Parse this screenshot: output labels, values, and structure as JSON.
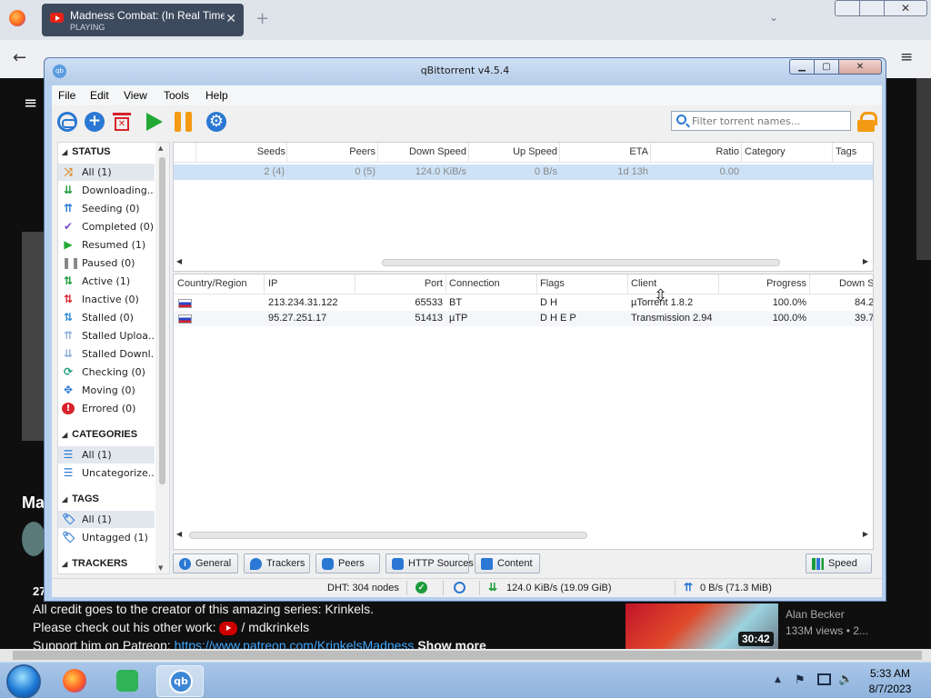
{
  "browser": {
    "tab_title": "Madness Combat: (In Real Time",
    "tab_status": "PLAYING",
    "new_tab": "+",
    "close_tab": "✕"
  },
  "youtube": {
    "title": "Ma",
    "views_fragment": "27",
    "description_line1": "All credit goes to the creator of this amazing series: Krinkels.",
    "description_line2_prefix": "Please check out his other work:",
    "description_line2_channel": "/ mdkrinkels",
    "description_line3_prefix": "Support him on Patreon:",
    "description_line3_link": "https://www.patreon.com/KrinkelsMadness",
    "show_more": "Show more",
    "rec_duration": "30:42",
    "rec_channel": "Alan Becker",
    "rec_views": "133M views • 2..."
  },
  "taskbar": {
    "time": "5:33 AM",
    "date": "8/7/2023",
    "qb_label": "qb"
  },
  "qbittorrent": {
    "window_title": "qBittorrent v4.5.4",
    "menu": [
      "File",
      "Edit",
      "View",
      "Tools",
      "Help"
    ],
    "search_placeholder": "Filter torrent names...",
    "sidebar": {
      "status_header": "STATUS",
      "status_items": [
        {
          "label": "All (1)",
          "icon": "all-icon"
        },
        {
          "label": "Downloading...",
          "icon": "downloading-icon"
        },
        {
          "label": "Seeding (0)",
          "icon": "seeding-icon"
        },
        {
          "label": "Completed (0)",
          "icon": "completed-icon"
        },
        {
          "label": "Resumed (1)",
          "icon": "resumed-icon"
        },
        {
          "label": "Paused (0)",
          "icon": "paused-icon"
        },
        {
          "label": "Active (1)",
          "icon": "active-icon"
        },
        {
          "label": "Inactive (0)",
          "icon": "inactive-icon"
        },
        {
          "label": "Stalled (0)",
          "icon": "stalled-icon"
        },
        {
          "label": "Stalled Uploa...",
          "icon": "stalled-uploading-icon"
        },
        {
          "label": "Stalled Downl...",
          "icon": "stalled-downloading-icon"
        },
        {
          "label": "Checking (0)",
          "icon": "checking-icon"
        },
        {
          "label": "Moving (0)",
          "icon": "moving-icon"
        },
        {
          "label": "Errored (0)",
          "icon": "errored-icon"
        }
      ],
      "categories_header": "CATEGORIES",
      "category_items": [
        {
          "label": "All (1)"
        },
        {
          "label": "Uncategorize..."
        }
      ],
      "tags_header": "TAGS",
      "tag_items": [
        {
          "label": "All (1)"
        },
        {
          "label": "Untagged (1)"
        }
      ],
      "trackers_header": "TRACKERS"
    },
    "torrent_columns": [
      "Seeds",
      "Peers",
      "Down Speed",
      "Up Speed",
      "ETA",
      "Ratio",
      "Category",
      "Tags"
    ],
    "torrent_row": {
      "seeds": "2 (4)",
      "peers": "0 (5)",
      "down_speed": "124.0 KiB/s",
      "up_speed": "0 B/s",
      "eta": "1d 13h",
      "ratio": "0.00"
    },
    "peer_columns": [
      "Country/Region",
      "IP",
      "Port",
      "Connection",
      "Flags",
      "Client",
      "Progress",
      "Down S"
    ],
    "peers": [
      {
        "ip": "213.234.31.122",
        "port": "65533",
        "connection": "BT",
        "flags": "D H",
        "client": "µTorrent 1.8.2",
        "progress": "100.0%",
        "down": "84.2"
      },
      {
        "ip": "95.27.251.17",
        "port": "51413",
        "connection": "µTP",
        "flags": "D H E P",
        "client": "Transmission 2.94",
        "progress": "100.0%",
        "down": "39.7"
      }
    ],
    "bottom_tabs": {
      "general": "General",
      "trackers": "Trackers",
      "peers": "Peers",
      "http_sources": "HTTP Sources",
      "content": "Content",
      "speed": "Speed"
    },
    "status_bar": {
      "dht": "DHT: 304 nodes",
      "download": "124.0 KiB/s (19.09 GiB)",
      "upload": "0 B/s (71.3 MiB)"
    }
  },
  "colors": {
    "accent_blue": "#2a78d3",
    "resume_green": "#22a935",
    "pause_orange": "#f39a12",
    "delete_red": "#d8212a",
    "row_selected": "#cde2f6"
  }
}
